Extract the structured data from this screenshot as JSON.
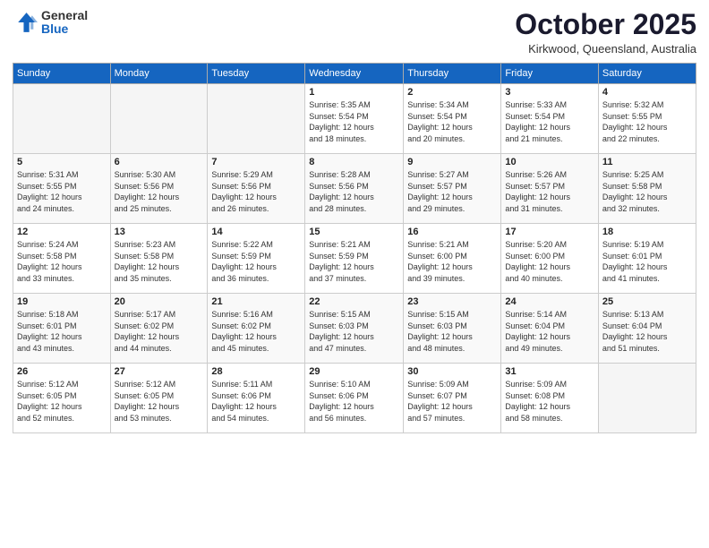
{
  "logo": {
    "general": "General",
    "blue": "Blue"
  },
  "header": {
    "month": "October 2025",
    "location": "Kirkwood, Queensland, Australia"
  },
  "weekdays": [
    "Sunday",
    "Monday",
    "Tuesday",
    "Wednesday",
    "Thursday",
    "Friday",
    "Saturday"
  ],
  "weeks": [
    [
      {
        "day": "",
        "info": ""
      },
      {
        "day": "",
        "info": ""
      },
      {
        "day": "",
        "info": ""
      },
      {
        "day": "1",
        "info": "Sunrise: 5:35 AM\nSunset: 5:54 PM\nDaylight: 12 hours\nand 18 minutes."
      },
      {
        "day": "2",
        "info": "Sunrise: 5:34 AM\nSunset: 5:54 PM\nDaylight: 12 hours\nand 20 minutes."
      },
      {
        "day": "3",
        "info": "Sunrise: 5:33 AM\nSunset: 5:54 PM\nDaylight: 12 hours\nand 21 minutes."
      },
      {
        "day": "4",
        "info": "Sunrise: 5:32 AM\nSunset: 5:55 PM\nDaylight: 12 hours\nand 22 minutes."
      }
    ],
    [
      {
        "day": "5",
        "info": "Sunrise: 5:31 AM\nSunset: 5:55 PM\nDaylight: 12 hours\nand 24 minutes."
      },
      {
        "day": "6",
        "info": "Sunrise: 5:30 AM\nSunset: 5:56 PM\nDaylight: 12 hours\nand 25 minutes."
      },
      {
        "day": "7",
        "info": "Sunrise: 5:29 AM\nSunset: 5:56 PM\nDaylight: 12 hours\nand 26 minutes."
      },
      {
        "day": "8",
        "info": "Sunrise: 5:28 AM\nSunset: 5:56 PM\nDaylight: 12 hours\nand 28 minutes."
      },
      {
        "day": "9",
        "info": "Sunrise: 5:27 AM\nSunset: 5:57 PM\nDaylight: 12 hours\nand 29 minutes."
      },
      {
        "day": "10",
        "info": "Sunrise: 5:26 AM\nSunset: 5:57 PM\nDaylight: 12 hours\nand 31 minutes."
      },
      {
        "day": "11",
        "info": "Sunrise: 5:25 AM\nSunset: 5:58 PM\nDaylight: 12 hours\nand 32 minutes."
      }
    ],
    [
      {
        "day": "12",
        "info": "Sunrise: 5:24 AM\nSunset: 5:58 PM\nDaylight: 12 hours\nand 33 minutes."
      },
      {
        "day": "13",
        "info": "Sunrise: 5:23 AM\nSunset: 5:58 PM\nDaylight: 12 hours\nand 35 minutes."
      },
      {
        "day": "14",
        "info": "Sunrise: 5:22 AM\nSunset: 5:59 PM\nDaylight: 12 hours\nand 36 minutes."
      },
      {
        "day": "15",
        "info": "Sunrise: 5:21 AM\nSunset: 5:59 PM\nDaylight: 12 hours\nand 37 minutes."
      },
      {
        "day": "16",
        "info": "Sunrise: 5:21 AM\nSunset: 6:00 PM\nDaylight: 12 hours\nand 39 minutes."
      },
      {
        "day": "17",
        "info": "Sunrise: 5:20 AM\nSunset: 6:00 PM\nDaylight: 12 hours\nand 40 minutes."
      },
      {
        "day": "18",
        "info": "Sunrise: 5:19 AM\nSunset: 6:01 PM\nDaylight: 12 hours\nand 41 minutes."
      }
    ],
    [
      {
        "day": "19",
        "info": "Sunrise: 5:18 AM\nSunset: 6:01 PM\nDaylight: 12 hours\nand 43 minutes."
      },
      {
        "day": "20",
        "info": "Sunrise: 5:17 AM\nSunset: 6:02 PM\nDaylight: 12 hours\nand 44 minutes."
      },
      {
        "day": "21",
        "info": "Sunrise: 5:16 AM\nSunset: 6:02 PM\nDaylight: 12 hours\nand 45 minutes."
      },
      {
        "day": "22",
        "info": "Sunrise: 5:15 AM\nSunset: 6:03 PM\nDaylight: 12 hours\nand 47 minutes."
      },
      {
        "day": "23",
        "info": "Sunrise: 5:15 AM\nSunset: 6:03 PM\nDaylight: 12 hours\nand 48 minutes."
      },
      {
        "day": "24",
        "info": "Sunrise: 5:14 AM\nSunset: 6:04 PM\nDaylight: 12 hours\nand 49 minutes."
      },
      {
        "day": "25",
        "info": "Sunrise: 5:13 AM\nSunset: 6:04 PM\nDaylight: 12 hours\nand 51 minutes."
      }
    ],
    [
      {
        "day": "26",
        "info": "Sunrise: 5:12 AM\nSunset: 6:05 PM\nDaylight: 12 hours\nand 52 minutes."
      },
      {
        "day": "27",
        "info": "Sunrise: 5:12 AM\nSunset: 6:05 PM\nDaylight: 12 hours\nand 53 minutes."
      },
      {
        "day": "28",
        "info": "Sunrise: 5:11 AM\nSunset: 6:06 PM\nDaylight: 12 hours\nand 54 minutes."
      },
      {
        "day": "29",
        "info": "Sunrise: 5:10 AM\nSunset: 6:06 PM\nDaylight: 12 hours\nand 56 minutes."
      },
      {
        "day": "30",
        "info": "Sunrise: 5:09 AM\nSunset: 6:07 PM\nDaylight: 12 hours\nand 57 minutes."
      },
      {
        "day": "31",
        "info": "Sunrise: 5:09 AM\nSunset: 6:08 PM\nDaylight: 12 hours\nand 58 minutes."
      },
      {
        "day": "",
        "info": ""
      }
    ]
  ]
}
